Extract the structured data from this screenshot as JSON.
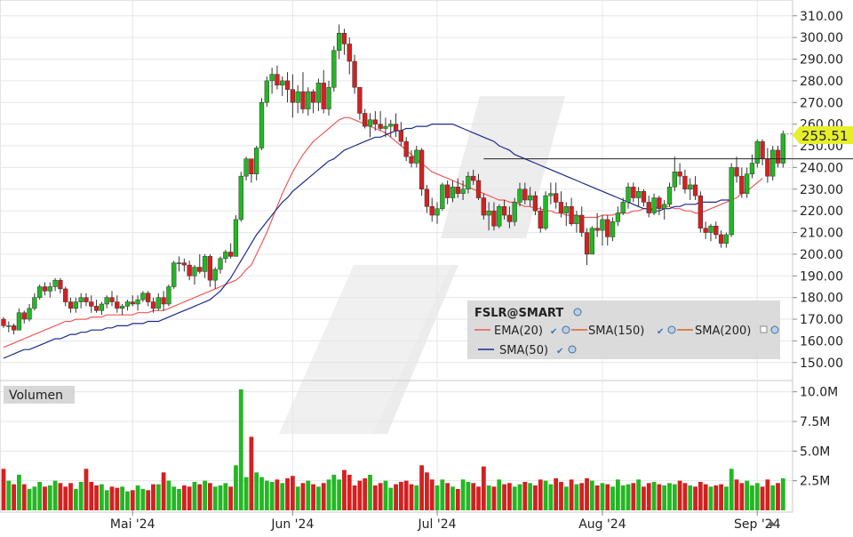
{
  "chart_data": {
    "type": "candlestick",
    "symbol": "FSLR@SMART",
    "last_price_label": "255.51",
    "last_price": 255.51,
    "price_axis": {
      "ticks": [
        "310.00",
        "300.00",
        "290.00",
        "280.00",
        "270.00",
        "260.00",
        "250.00",
        "240.00",
        "230.00",
        "220.00",
        "210.00",
        "200.00",
        "190.00",
        "180.00",
        "170.00",
        "160.00",
        "150.00"
      ],
      "ylim": [
        145,
        314
      ]
    },
    "volume_axis": {
      "title": "Volumen",
      "ticks": [
        "10.0M",
        "7.5M",
        "5.0M",
        "2.5M"
      ],
      "ylim": [
        0,
        10500000
      ]
    },
    "x_axis": {
      "labels": [
        {
          "text": "Mai '24",
          "bar": 25
        },
        {
          "text": "Jun '24",
          "bar": 56
        },
        {
          "text": "Jul '24",
          "bar": 84
        },
        {
          "text": "Aug '24",
          "bar": 116
        },
        {
          "text": "Sep '24",
          "bar": 146
        }
      ]
    },
    "legend": [
      {
        "label": "EMA(20)",
        "color": "#ee5a5a"
      },
      {
        "label": "SMA(150)",
        "color": "#d8632a"
      },
      {
        "label": "SMA(200)",
        "color": "#d8632a"
      },
      {
        "label": "SMA(50)",
        "color": "#1a2a8f"
      }
    ],
    "horizontal_line": {
      "price": 244,
      "from_bar": 93,
      "to_bar": 170
    },
    "colors": {
      "up": "#22b822",
      "down": "#d42020",
      "ema20": "#ee5a5a",
      "sma50": "#1a2a8f",
      "price_tag": "#e6ef2a",
      "grid": "#e6e6e6"
    },
    "candles": [
      [
        170,
        171,
        166,
        167,
        3500000
      ],
      [
        167,
        169,
        164,
        167,
        2500000
      ],
      [
        167,
        168,
        163,
        165,
        2200000
      ],
      [
        165,
        175,
        165,
        173,
        3000000
      ],
      [
        173,
        174,
        168,
        170,
        2200000
      ],
      [
        170,
        177,
        169,
        175,
        1800000
      ],
      [
        175,
        182,
        174,
        180,
        2000000
      ],
      [
        180,
        186,
        179,
        185,
        2400000
      ],
      [
        185,
        187,
        181,
        183,
        2000000
      ],
      [
        183,
        187,
        180,
        185,
        2100000
      ],
      [
        185,
        189,
        183,
        188,
        2500000
      ],
      [
        188,
        189,
        182,
        184,
        2300000
      ],
      [
        184,
        185,
        176,
        178,
        2000000
      ],
      [
        178,
        180,
        173,
        175,
        2300000
      ],
      [
        175,
        180,
        173,
        178,
        1800000
      ],
      [
        178,
        182,
        175,
        180,
        2400000
      ],
      [
        180,
        182,
        176,
        178,
        3500000
      ],
      [
        178,
        181,
        173,
        176,
        2400000
      ],
      [
        176,
        179,
        173,
        174,
        2100000
      ],
      [
        174,
        178,
        172,
        177,
        2200000
      ],
      [
        177,
        181,
        175,
        180,
        1700000
      ],
      [
        180,
        183,
        176,
        178,
        2000000
      ],
      [
        178,
        181,
        173,
        175,
        1900000
      ],
      [
        175,
        177,
        172,
        176,
        2000000
      ],
      [
        176,
        179,
        174,
        178,
        1600000
      ],
      [
        178,
        181,
        176,
        177,
        1700000
      ],
      [
        177,
        181,
        174,
        179,
        2100000
      ],
      [
        179,
        183,
        178,
        182,
        1800000
      ],
      [
        182,
        183,
        176,
        178,
        1700000
      ],
      [
        178,
        180,
        173,
        175,
        2200000
      ],
      [
        175,
        182,
        174,
        180,
        2200000
      ],
      [
        180,
        183,
        174,
        177,
        3200000
      ],
      [
        177,
        186,
        176,
        185,
        2500000
      ],
      [
        185,
        197,
        184,
        196,
        2000000
      ],
      [
        196,
        199,
        192,
        196,
        1800000
      ],
      [
        196,
        198,
        192,
        195,
        2100000
      ],
      [
        195,
        197,
        188,
        190,
        2000000
      ],
      [
        190,
        195,
        186,
        194,
        2400000
      ],
      [
        194,
        200,
        191,
        192,
        2200000
      ],
      [
        192,
        200,
        189,
        199,
        2500000
      ],
      [
        199,
        200,
        185,
        188,
        2300000
      ],
      [
        188,
        194,
        184,
        193,
        2000000
      ],
      [
        193,
        199,
        191,
        198,
        2100000
      ],
      [
        198,
        202,
        196,
        201,
        2300000
      ],
      [
        201,
        205,
        198,
        199,
        2000000
      ],
      [
        199,
        218,
        199,
        216,
        3800000
      ],
      [
        216,
        238,
        215,
        236,
        10200000
      ],
      [
        236,
        245,
        234,
        244,
        2800000
      ],
      [
        244,
        243,
        233,
        237,
        6200000
      ],
      [
        237,
        250,
        234,
        249,
        3200000
      ],
      [
        249,
        272,
        248,
        270,
        2800000
      ],
      [
        270,
        282,
        268,
        280,
        2500000
      ],
      [
        280,
        286,
        274,
        283,
        2400000
      ],
      [
        283,
        287,
        276,
        278,
        2600000
      ],
      [
        278,
        282,
        273,
        280,
        2300000
      ],
      [
        280,
        284,
        270,
        276,
        2700000
      ],
      [
        276,
        283,
        263,
        270,
        2900000
      ],
      [
        270,
        278,
        265,
        275,
        2000000
      ],
      [
        275,
        284,
        265,
        267,
        2300000
      ],
      [
        267,
        277,
        264,
        275,
        2500000
      ],
      [
        275,
        276,
        265,
        270,
        2200000
      ],
      [
        270,
        281,
        266,
        279,
        2000000
      ],
      [
        279,
        285,
        265,
        267,
        2300000
      ],
      [
        267,
        280,
        264,
        277,
        2600000
      ],
      [
        277,
        296,
        275,
        294,
        3000000
      ],
      [
        294,
        306,
        290,
        302,
        2600000
      ],
      [
        302,
        304,
        292,
        297,
        3400000
      ],
      [
        297,
        300,
        283,
        289,
        3000000
      ],
      [
        289,
        292,
        274,
        277,
        2100000
      ],
      [
        277,
        277,
        262,
        265,
        2500000
      ],
      [
        265,
        267,
        258,
        259,
        2700000
      ],
      [
        259,
        265,
        254,
        262,
        3000000
      ],
      [
        262,
        266,
        257,
        260,
        2100000
      ],
      [
        260,
        266,
        257,
        258,
        2300000
      ],
      [
        258,
        263,
        254,
        259,
        2500000
      ],
      [
        259,
        262,
        254,
        260,
        1900000
      ],
      [
        260,
        265,
        254,
        257,
        2200000
      ],
      [
        257,
        261,
        250,
        252,
        2400000
      ],
      [
        252,
        254,
        243,
        245,
        2500000
      ],
      [
        245,
        248,
        240,
        242,
        2200000
      ],
      [
        242,
        250,
        240,
        248,
        2100000
      ],
      [
        248,
        249,
        227,
        230,
        3800000
      ],
      [
        230,
        232,
        219,
        222,
        3200000
      ],
      [
        222,
        226,
        215,
        218,
        2600000
      ],
      [
        218,
        224,
        214,
        221,
        2100000
      ],
      [
        221,
        233,
        220,
        232,
        2600000
      ],
      [
        232,
        234,
        223,
        226,
        2300000
      ],
      [
        226,
        234,
        224,
        231,
        2000000
      ],
      [
        231,
        235,
        226,
        228,
        1800000
      ],
      [
        228,
        234,
        225,
        230,
        2600000
      ],
      [
        230,
        238,
        228,
        236,
        2400000
      ],
      [
        236,
        239,
        232,
        234,
        2300000
      ],
      [
        234,
        237,
        225,
        226,
        2000000
      ],
      [
        226,
        228,
        216,
        218,
        3700000
      ],
      [
        218,
        224,
        211,
        220,
        2100000
      ],
      [
        220,
        224,
        211,
        213,
        2000000
      ],
      [
        213,
        223,
        212,
        222,
        2600000
      ],
      [
        222,
        225,
        216,
        218,
        2200000
      ],
      [
        218,
        222,
        212,
        215,
        2300000
      ],
      [
        215,
        226,
        213,
        224,
        2000000
      ],
      [
        224,
        233,
        222,
        230,
        2200000
      ],
      [
        230,
        233,
        223,
        225,
        2400000
      ],
      [
        225,
        231,
        222,
        227,
        2300000
      ],
      [
        227,
        229,
        218,
        220,
        2100000
      ],
      [
        220,
        222,
        210,
        212,
        2600000
      ],
      [
        212,
        229,
        211,
        227,
        2500000
      ],
      [
        227,
        233,
        223,
        228,
        2200000
      ],
      [
        228,
        233,
        221,
        224,
        2700000
      ],
      [
        224,
        229,
        217,
        219,
        2400000
      ],
      [
        219,
        224,
        213,
        222,
        2000000
      ],
      [
        222,
        226,
        213,
        214,
        2600000
      ],
      [
        214,
        220,
        210,
        218,
        2200000
      ],
      [
        218,
        222,
        208,
        210,
        2300000
      ],
      [
        210,
        212,
        195,
        200,
        2700000
      ],
      [
        200,
        213,
        200,
        212,
        2500000
      ],
      [
        212,
        219,
        208,
        211,
        2100000
      ],
      [
        211,
        218,
        204,
        216,
        2300000
      ],
      [
        216,
        218,
        204,
        208,
        2200000
      ],
      [
        208,
        217,
        206,
        215,
        2000000
      ],
      [
        215,
        222,
        213,
        219,
        2600000
      ],
      [
        219,
        226,
        218,
        224,
        2100000
      ],
      [
        224,
        233,
        221,
        231,
        2200000
      ],
      [
        231,
        233,
        224,
        226,
        2300000
      ],
      [
        226,
        231,
        222,
        229,
        2600000
      ],
      [
        229,
        230,
        222,
        224,
        2000000
      ],
      [
        224,
        227,
        217,
        219,
        2300000
      ],
      [
        219,
        228,
        218,
        226,
        2400000
      ],
      [
        226,
        227,
        218,
        221,
        2200000
      ],
      [
        221,
        225,
        216,
        223,
        2100000
      ],
      [
        223,
        233,
        222,
        231,
        2300000
      ],
      [
        231,
        245,
        229,
        238,
        2200000
      ],
      [
        238,
        242,
        232,
        236,
        2500000
      ],
      [
        236,
        239,
        228,
        230,
        2300000
      ],
      [
        230,
        235,
        225,
        232,
        2100000
      ],
      [
        232,
        236,
        225,
        227,
        2000000
      ],
      [
        227,
        229,
        210,
        212,
        2400000
      ],
      [
        212,
        215,
        207,
        210,
        2200000
      ],
      [
        210,
        214,
        206,
        213,
        2000000
      ],
      [
        213,
        215,
        207,
        209,
        2100000
      ],
      [
        209,
        211,
        203,
        205,
        2200000
      ],
      [
        205,
        210,
        203,
        209,
        2000000
      ],
      [
        209,
        242,
        208,
        240,
        3500000
      ],
      [
        240,
        245,
        233,
        236,
        2600000
      ],
      [
        236,
        240,
        226,
        228,
        2300000
      ],
      [
        228,
        240,
        226,
        237,
        2500000
      ],
      [
        237,
        246,
        235,
        242,
        2100000
      ],
      [
        242,
        253,
        240,
        252,
        2300000
      ],
      [
        252,
        253,
        241,
        244,
        2000000
      ],
      [
        244,
        249,
        233,
        236,
        2600000
      ],
      [
        236,
        250,
        234,
        248,
        2100000
      ],
      [
        248,
        250,
        240,
        242,
        2300000
      ],
      [
        242,
        257,
        240,
        255.51,
        2700000
      ]
    ],
    "ema20": [
      157,
      158,
      159,
      160,
      161,
      162,
      163,
      164,
      165,
      166,
      167,
      168,
      169,
      169,
      170,
      170,
      170,
      171,
      171,
      171,
      172,
      172,
      172,
      172,
      172,
      172,
      173,
      173,
      173,
      174,
      174,
      174,
      175,
      176,
      177,
      178,
      179,
      180,
      181,
      182,
      183,
      184,
      185,
      186,
      187,
      188,
      190,
      193,
      195,
      200,
      205,
      210,
      216,
      222,
      228,
      233,
      238,
      242,
      246,
      249,
      252,
      254,
      256,
      258,
      260,
      262,
      263,
      263,
      262,
      261,
      260,
      259,
      258,
      257,
      256,
      254,
      252,
      250,
      248,
      246,
      244,
      242,
      240,
      238,
      237,
      236,
      235,
      234,
      233,
      232,
      231,
      230,
      229,
      228,
      227,
      226,
      225,
      225,
      224,
      224,
      223,
      222,
      222,
      221,
      221,
      220,
      220,
      219,
      219,
      218,
      218,
      218,
      217,
      217,
      217,
      217,
      218,
      218,
      218,
      219,
      219,
      219,
      220,
      220,
      221,
      221,
      221,
      222,
      222,
      222,
      221,
      221,
      220,
      220,
      219,
      219,
      220,
      221,
      222,
      223,
      224,
      225,
      226,
      228,
      229,
      231,
      233,
      235
    ],
    "sma50": [
      152,
      153,
      154,
      155,
      156,
      156,
      157,
      158,
      159,
      160,
      161,
      161,
      162,
      163,
      163,
      164,
      164,
      165,
      165,
      165,
      166,
      166,
      167,
      167,
      167,
      168,
      168,
      168,
      169,
      169,
      169,
      170,
      171,
      172,
      173,
      174,
      175,
      176,
      177,
      178,
      179,
      181,
      183,
      186,
      189,
      193,
      197,
      201,
      205,
      209,
      212,
      215,
      218,
      221,
      224,
      226,
      229,
      231,
      233,
      235,
      237,
      239,
      241,
      243,
      244,
      246,
      248,
      249,
      250,
      251,
      252,
      253,
      254,
      254,
      255,
      256,
      257,
      257,
      258,
      258,
      259,
      259,
      259,
      260,
      260,
      260,
      260,
      260,
      259,
      258,
      257,
      256,
      255,
      254,
      253,
      252,
      250,
      249,
      248,
      246,
      245,
      244,
      243,
      242,
      241,
      240,
      239,
      238,
      237,
      236,
      235,
      234,
      233,
      232,
      231,
      230,
      229,
      228,
      227,
      226,
      225,
      224,
      223,
      222,
      221,
      221,
      220,
      220,
      221,
      221,
      222,
      222,
      223,
      223,
      223,
      224,
      224,
      224,
      224,
      225,
      225,
      225
    ]
  }
}
